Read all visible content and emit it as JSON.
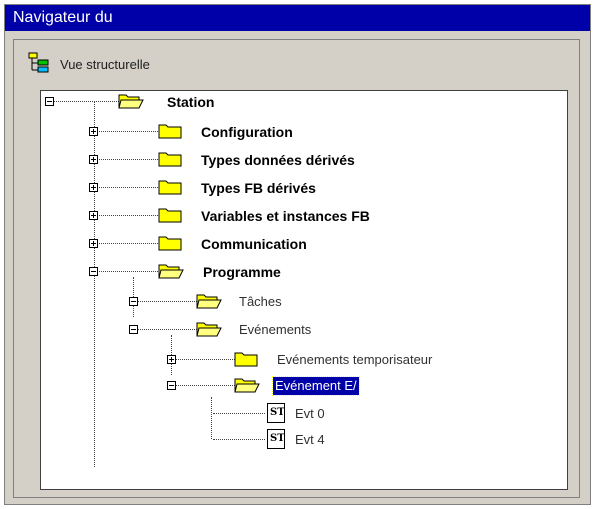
{
  "window": {
    "title": "Navigateur du"
  },
  "header": {
    "label": "Vue structurelle",
    "icon": "tree-structure-icon"
  },
  "tree": {
    "root": {
      "label": "Station",
      "expanded": true
    },
    "items": [
      {
        "label": "Configuration",
        "expanded": false
      },
      {
        "label": "Types données dérivés",
        "expanded": false
      },
      {
        "label": "Types FB dérivés",
        "expanded": false
      },
      {
        "label": "Variables et instances FB",
        "expanded": false
      },
      {
        "label": "Communication",
        "expanded": false
      },
      {
        "label": "Programme",
        "expanded": true
      }
    ],
    "programme_children": [
      {
        "label": "Tâches",
        "expanded": true
      },
      {
        "label": "Evénements",
        "expanded": true
      }
    ],
    "evenements_children": [
      {
        "label": "Evénements temporisateur",
        "expanded": false
      },
      {
        "label": "Evénement E/",
        "expanded": true,
        "selected": true
      }
    ],
    "evenement_es_children": [
      {
        "label": "Evt 0",
        "icon": "st-section-icon",
        "icon_text": "ST"
      },
      {
        "label": "Evt 4",
        "icon": "st-section-icon",
        "icon_text": "ST"
      }
    ]
  },
  "colors": {
    "titlebar": "#0000a8",
    "folder": "#ffff00",
    "selection": "#0000a8"
  }
}
